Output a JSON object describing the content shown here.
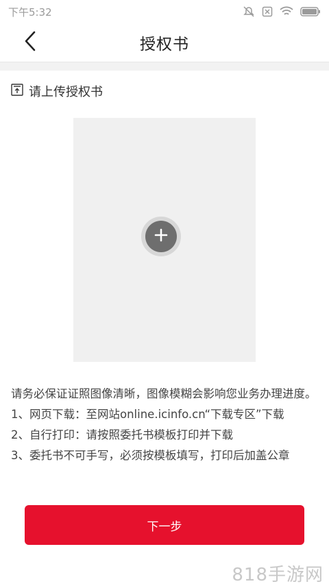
{
  "status_bar": {
    "time": "下午5:32",
    "icons": [
      "mute-icon",
      "sim-x-icon",
      "wifi-icon",
      "battery-icon"
    ]
  },
  "header": {
    "title": "授权书",
    "back_icon": "chevron-left-icon"
  },
  "upload": {
    "section_label": "请上传授权书",
    "section_icon": "upload-icon",
    "add_icon": "plus-icon"
  },
  "notice": {
    "lines": [
      "请务必保证证照图像清晰，图像模糊会影响您业务办理进度。",
      "1、网页下载：至网站online.icinfo.cn“下载专区”下载",
      "2、自行打印：请按照委托书模板打印并下载",
      "3、委托书不可手写，必须按模板填写，打印后加盖公章"
    ]
  },
  "actions": {
    "next_label": "下一步"
  },
  "watermark": "818手游网",
  "colors": {
    "primary_red": "#e6112d",
    "upload_bg": "#f0f0f0",
    "add_button": "#6e6e6e"
  }
}
